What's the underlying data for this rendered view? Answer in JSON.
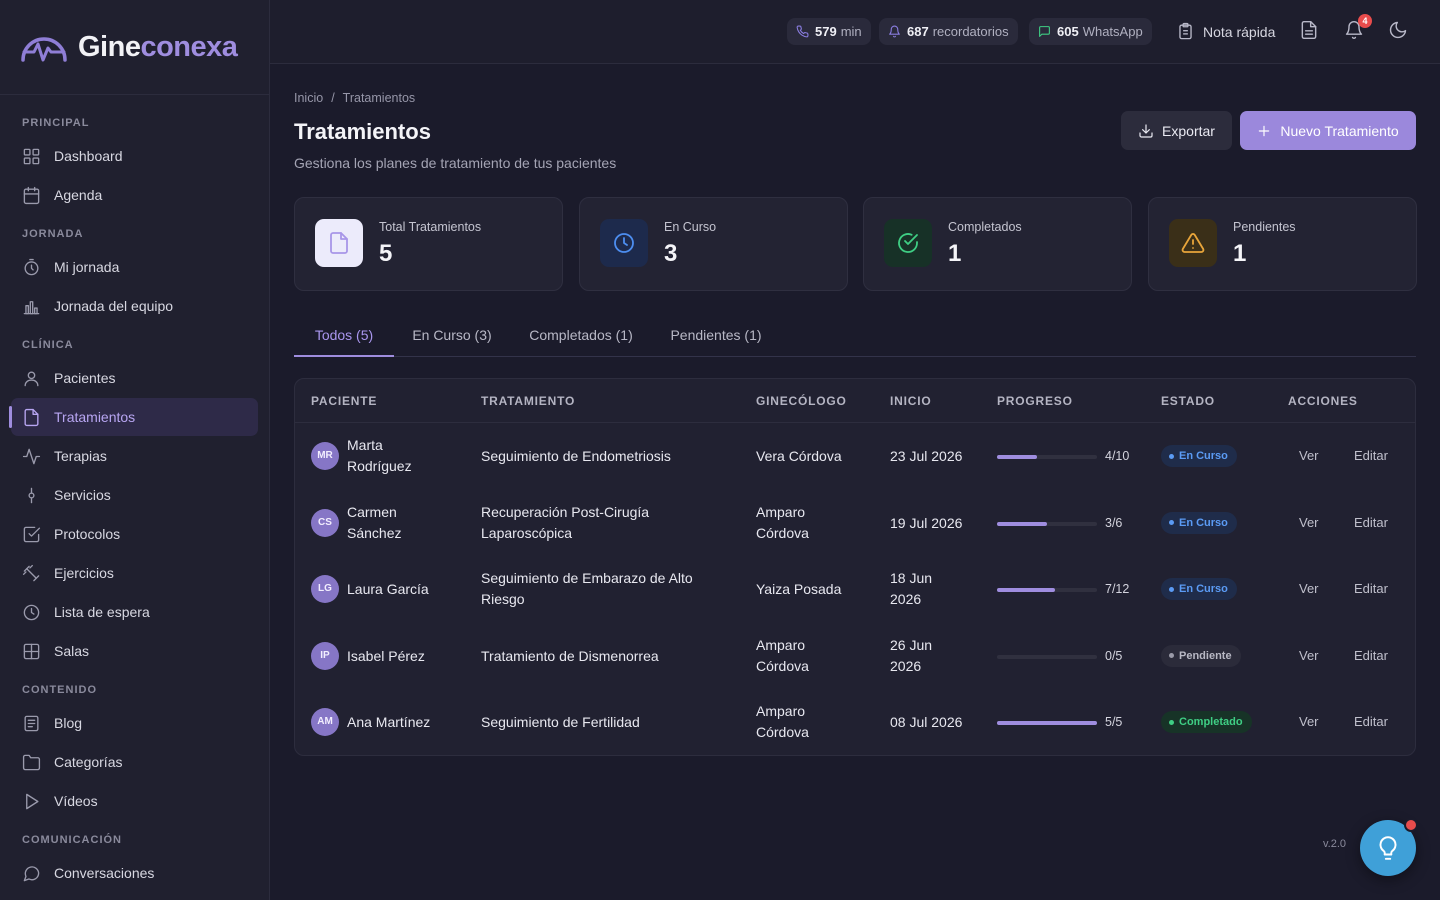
{
  "brand": {
    "part1": "Gine",
    "part2": "conexa"
  },
  "sidebar": {
    "sections": [
      {
        "title": "PRINCIPAL",
        "items": [
          {
            "label": "Dashboard",
            "icon": "grid-icon"
          },
          {
            "label": "Agenda",
            "icon": "calendar-icon"
          }
        ]
      },
      {
        "title": "JORNADA",
        "items": [
          {
            "label": "Mi jornada",
            "icon": "stopwatch-icon"
          },
          {
            "label": "Jornada del equipo",
            "icon": "bar-chart-icon"
          }
        ]
      },
      {
        "title": "CLÍNICA",
        "items": [
          {
            "label": "Pacientes",
            "icon": "user-icon"
          },
          {
            "label": "Tratamientos",
            "icon": "file-icon",
            "active": true
          },
          {
            "label": "Terapias",
            "icon": "activity-icon"
          },
          {
            "label": "Servicios",
            "icon": "git-commit-icon"
          },
          {
            "label": "Protocolos",
            "icon": "checkbox-icon"
          },
          {
            "label": "Ejercicios",
            "icon": "dumbbell-icon"
          },
          {
            "label": "Lista de espera",
            "icon": "clock-icon"
          },
          {
            "label": "Salas",
            "icon": "layout-icon"
          }
        ]
      },
      {
        "title": "CONTENIDO",
        "items": [
          {
            "label": "Blog",
            "icon": "newspaper-icon"
          },
          {
            "label": "Categorías",
            "icon": "folder-icon"
          },
          {
            "label": "Vídeos",
            "icon": "play-icon"
          }
        ]
      },
      {
        "title": "COMUNICACIÓN",
        "items": [
          {
            "label": "Conversaciones",
            "icon": "chat-icon"
          }
        ]
      }
    ]
  },
  "topbar": {
    "minutes": {
      "value": "579",
      "unit": "min"
    },
    "reminders": {
      "value": "687",
      "unit": "recordatorios"
    },
    "whatsapp": {
      "value": "605",
      "unit": "WhatsApp"
    },
    "quick_note": "Nota rápida",
    "notifications_count": "4",
    "colors": {
      "phone": "#8a7de0",
      "bell": "#8a7de0",
      "whatsapp": "#3fce84"
    }
  },
  "page": {
    "breadcrumb": [
      "Inicio",
      "/",
      "Tratamientos"
    ],
    "title": "Tratamientos",
    "subtitle": "Gestiona los planes de tratamiento de tus pacientes",
    "export_label": "Exportar",
    "new_label": "Nuevo Tratamiento"
  },
  "stats": [
    {
      "label": "Total Tratamientos",
      "value": "5",
      "icon": "file-icon",
      "bg": "#ecebfb",
      "color": "#a896e8"
    },
    {
      "label": "En Curso",
      "value": "3",
      "icon": "clock-icon",
      "bg": "#1d2a4c",
      "color": "#4d8ef0"
    },
    {
      "label": "Completados",
      "value": "1",
      "icon": "check-circle-icon",
      "bg": "#173127",
      "color": "#3fce84"
    },
    {
      "label": "Pendientes",
      "value": "1",
      "icon": "warning-icon",
      "bg": "#3a2f18",
      "color": "#e8a53a"
    }
  ],
  "tabs": [
    {
      "label": "Todos (5)",
      "active": true
    },
    {
      "label": "En Curso (3)"
    },
    {
      "label": "Completados (1)"
    },
    {
      "label": "Pendientes (1)"
    }
  ],
  "table": {
    "headers": [
      "PACIENTE",
      "TRATAMIENTO",
      "GINECÓLOGO",
      "INICIO",
      "PROGRESO",
      "ESTADO",
      "ACCIONES"
    ],
    "actions": {
      "view": "Ver",
      "edit": "Editar"
    },
    "rows": [
      {
        "initials": "MR",
        "patient": [
          "Marta",
          "Rodríguez"
        ],
        "treatment": [
          "Seguimiento de Endometriosis"
        ],
        "doctor": [
          "Vera Córdova"
        ],
        "start": [
          "23 Jul 2026"
        ],
        "progress": "4/10",
        "progress_fraction": 0.4,
        "status": "En Curso",
        "status_type": "curso"
      },
      {
        "initials": "CS",
        "patient": [
          "Carmen",
          "Sánchez"
        ],
        "treatment": [
          "Recuperación Post-Cirugía",
          "Laparoscópica"
        ],
        "doctor": [
          "Amparo",
          "Córdova"
        ],
        "start": [
          "19 Jul 2026"
        ],
        "progress": "3/6",
        "progress_fraction": 0.5,
        "status": "En Curso",
        "status_type": "curso"
      },
      {
        "initials": "LG",
        "patient": [
          "Laura García"
        ],
        "treatment": [
          "Seguimiento de Embarazo de Alto",
          "Riesgo"
        ],
        "doctor": [
          "Yaiza Posada"
        ],
        "start": [
          "18 Jun",
          "2026"
        ],
        "progress": "7/12",
        "progress_fraction": 0.583,
        "status": "En Curso",
        "status_type": "curso"
      },
      {
        "initials": "IP",
        "patient": [
          "Isabel Pérez"
        ],
        "treatment": [
          "Tratamiento de Dismenorrea"
        ],
        "doctor": [
          "Amparo",
          "Córdova"
        ],
        "start": [
          "26 Jun",
          "2026"
        ],
        "progress": "0/5",
        "progress_fraction": 0,
        "status": "Pendiente",
        "status_type": "pend"
      },
      {
        "initials": "AM",
        "patient": [
          "Ana Martínez"
        ],
        "treatment": [
          "Seguimiento de Fertilidad"
        ],
        "doctor": [
          "Amparo",
          "Córdova"
        ],
        "start": [
          "08 Jul 2026"
        ],
        "progress": "5/5",
        "progress_fraction": 1,
        "status": "Completado",
        "status_type": "comp"
      }
    ]
  },
  "version": "v.2.0"
}
